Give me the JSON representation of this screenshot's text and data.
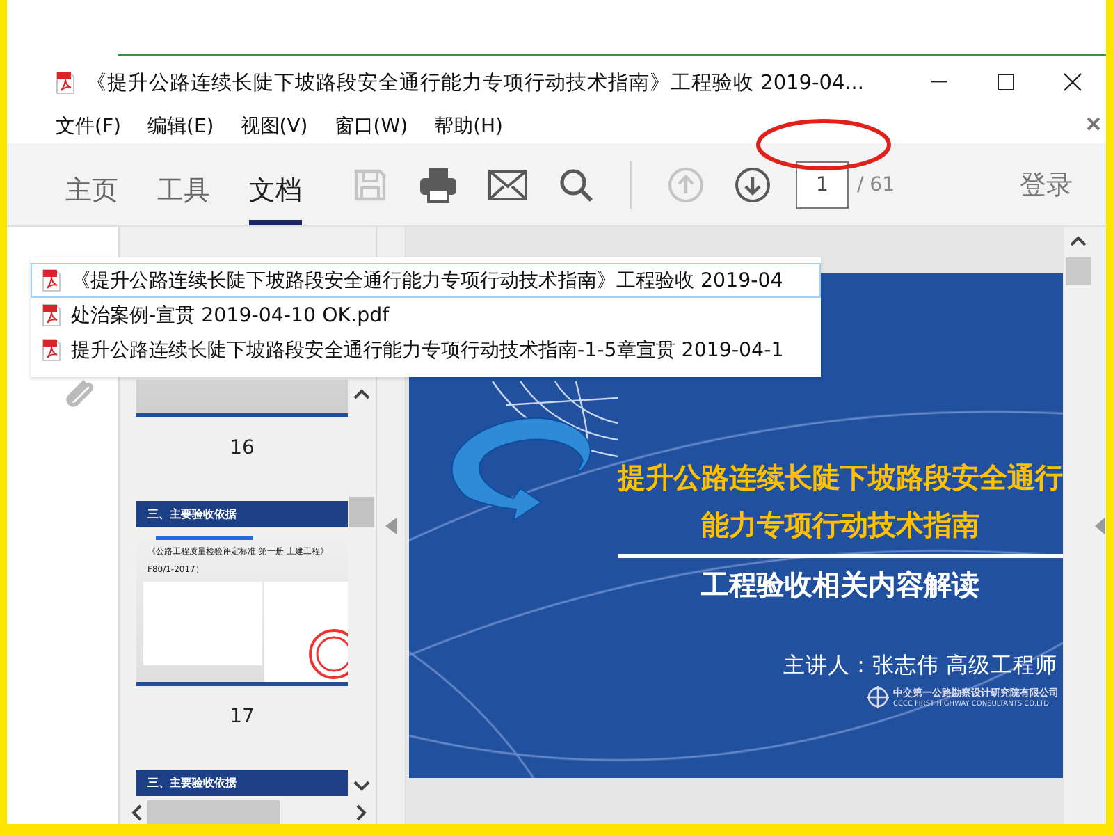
{
  "window": {
    "title": "《提升公路连续长陡下坡路段安全通行能力专项行动技术指南》工程验收 2019-04..."
  },
  "menu": [
    "文件(F)",
    "编辑(E)",
    "视图(V)",
    "窗口(W)",
    "帮助(H)"
  ],
  "toolbar": {
    "tabs": [
      {
        "label": "主页",
        "selected": false
      },
      {
        "label": "工具",
        "selected": false
      },
      {
        "label": "文档",
        "selected": true
      }
    ],
    "tools": [
      {
        "kind": "save",
        "disabled": true
      },
      {
        "kind": "print",
        "disabled": false
      },
      {
        "kind": "mail",
        "disabled": false
      },
      {
        "kind": "search",
        "disabled": false
      },
      {
        "kind": "divider"
      },
      {
        "kind": "up",
        "disabled": true
      },
      {
        "kind": "down",
        "disabled": false
      }
    ],
    "page": {
      "value": "1",
      "total": "/ 61"
    },
    "signin": "登录"
  },
  "recent_files": [
    {
      "name": "《提升公路连续长陡下坡路段安全通行能力专项行动技术指南》工程验收 2019-04",
      "selected": true
    },
    {
      "name": "处治案例-宣贯 2019-04-10 OK.pdf",
      "selected": false
    },
    {
      "name": "提升公路连续长陡下坡路段安全通行能力专项行动技术指南-1-5章宣贯 2019-04-1",
      "selected": false
    }
  ],
  "thumbnails": [
    {
      "kind": "cover",
      "label": "16"
    },
    {
      "kind": "content",
      "label": "17",
      "title": "三、主要验收依据",
      "lines": [
        "《公路工程质量检验评定标准 第一册 土建工程》",
        "F80/1-2017）"
      ]
    },
    {
      "kind": "content",
      "title": "三、主要验收依据"
    }
  ],
  "slide": {
    "title_lines": [
      "提升公路连续长陡下坡路段安全通行",
      "能力专项行动技术指南"
    ],
    "subtitle": "工程验收相关内容解读",
    "speaker": "主讲人：张志伟  高级工程师",
    "org": "中交第一公路勘察设计研究院有限公司",
    "org_en": "CCCC FIRST HIGHWAY CONSULTANTS CO.LTD"
  }
}
